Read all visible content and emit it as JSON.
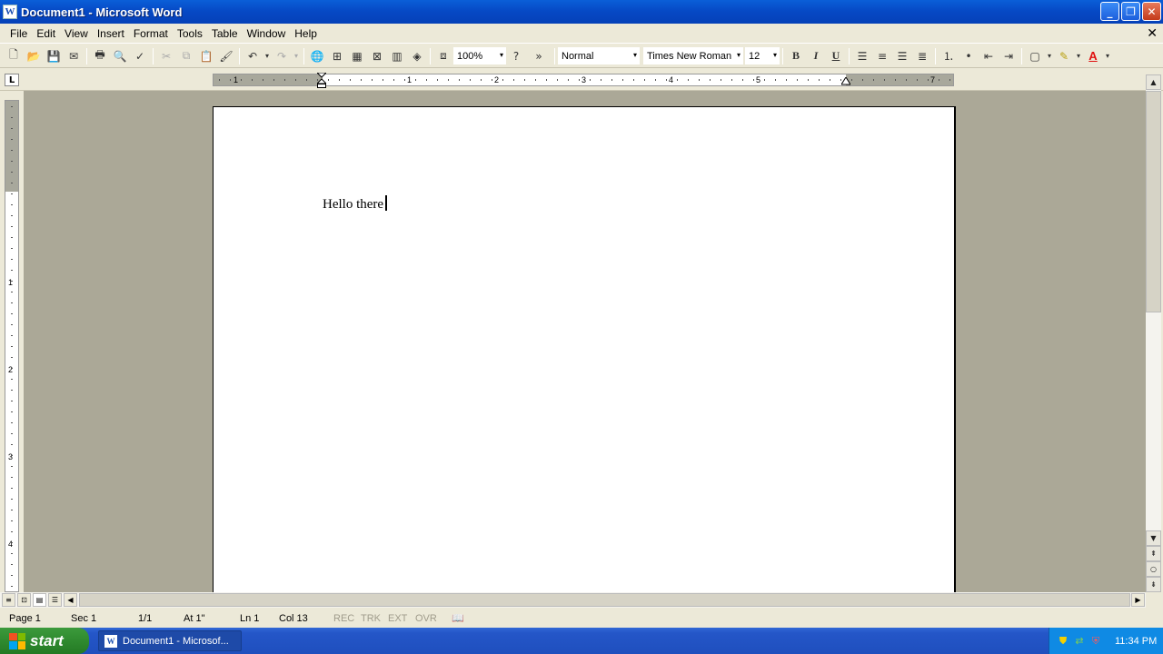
{
  "window": {
    "title": "Document1 - Microsoft Word",
    "minimize_glyph": "_",
    "restore_glyph": "❐",
    "close_glyph": "✕"
  },
  "menubar": {
    "items": [
      "File",
      "Edit",
      "View",
      "Insert",
      "Format",
      "Tools",
      "Table",
      "Window",
      "Help"
    ],
    "doc_close_glyph": "✕"
  },
  "toolbar": {
    "zoom": "100%",
    "style": "Normal",
    "font": "Times New Roman",
    "font_size": "12",
    "bold": "B",
    "italic": "I",
    "underline": "U",
    "more_glyph": "»",
    "combo_arrow": "▾"
  },
  "ruler": {
    "tab_selector": "L",
    "h_numbers": [
      "1",
      "1",
      "2",
      "3",
      "4",
      "5",
      "7"
    ],
    "v_numbers": [
      "1",
      "2",
      "3",
      "4"
    ]
  },
  "document": {
    "text": "Hello there"
  },
  "statusbar": {
    "page": "Page  1",
    "section": "Sec  1",
    "pages": "1/1",
    "at": "At  1\"",
    "line": "Ln  1",
    "col": "Col  13",
    "rec": "REC",
    "trk": "TRK",
    "ext": "EXT",
    "ovr": "OVR"
  },
  "taskbar": {
    "start_label": "start",
    "task_label": "Document1 - Microsof...",
    "clock": "11:34 PM"
  },
  "colors": {
    "title_blue": "#0648c4",
    "xp_face": "#ece9d8",
    "doc_background": "#aba897",
    "start_green": "#2f8a2f",
    "tray_blue": "#0f8ae4",
    "highlight_yellow": "#f4e41c",
    "font_color_red": "#e01010"
  }
}
